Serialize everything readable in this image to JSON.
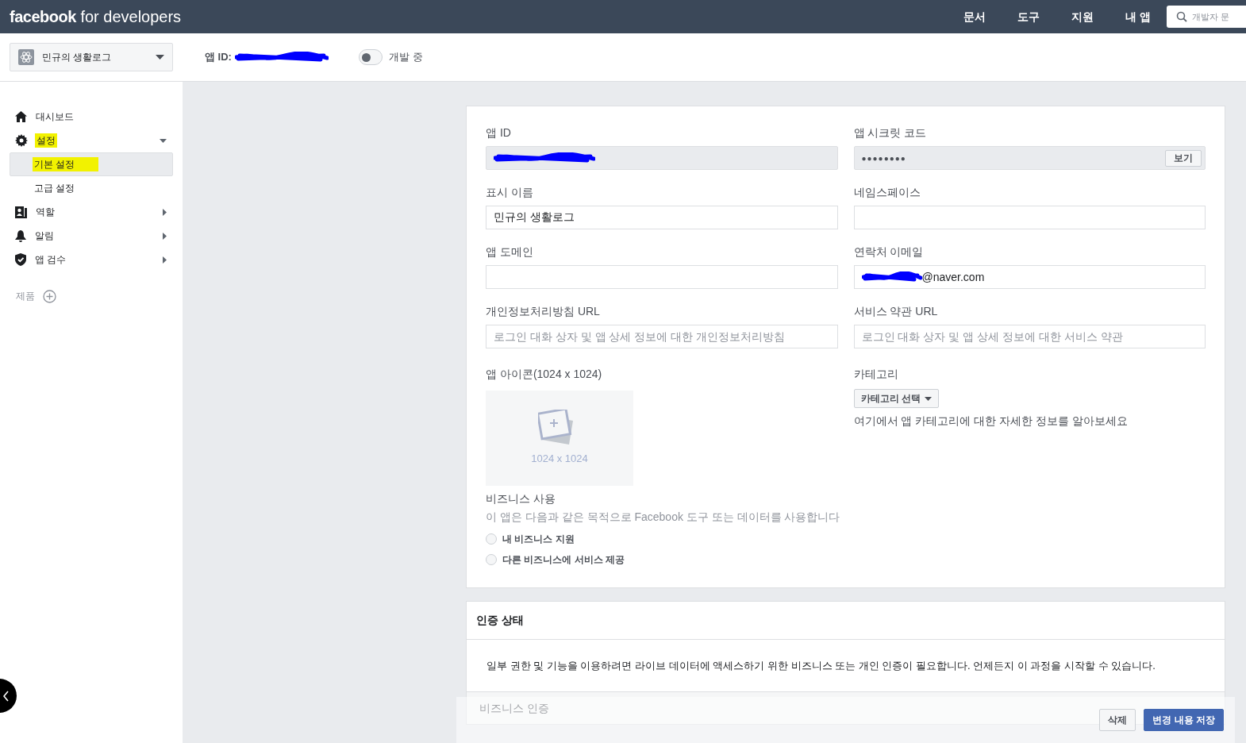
{
  "header": {
    "logo_bold": "facebook",
    "logo_rest": "for developers",
    "nav": [
      {
        "label": "문서"
      },
      {
        "label": "도구"
      },
      {
        "label": "지원"
      },
      {
        "label": "내 앱"
      }
    ],
    "search": {
      "placeholder": "개발자 문"
    }
  },
  "app_bar": {
    "app_name": "민규의 생활로그",
    "app_id_label": "앱 ID:",
    "mode_toggle": {
      "on": false,
      "label": "개발 중"
    }
  },
  "sidebar": {
    "items": [
      {
        "label": "대시보드",
        "kind": "home",
        "highlighted": false
      },
      {
        "label": "설정",
        "kind": "gear",
        "highlighted": true,
        "expanded": true,
        "children": [
          {
            "label": "기본 설정",
            "selected": true,
            "highlighted": true
          },
          {
            "label": "고급 설정",
            "selected": false,
            "highlighted": false
          }
        ]
      },
      {
        "label": "역할",
        "kind": "roles",
        "highlighted": false,
        "expanded": false
      },
      {
        "label": "알림",
        "kind": "bell",
        "highlighted": false,
        "expanded": false
      },
      {
        "label": "앱 검수",
        "kind": "shield",
        "highlighted": false,
        "expanded": false
      }
    ],
    "products_label": "제품"
  },
  "basic_settings": {
    "fields": [
      {
        "kind": "redacted",
        "label": "앱 ID"
      },
      {
        "kind": "secret",
        "label": "앱 시크릿 코드",
        "value": "●●●●●●●●",
        "button": "보기"
      },
      {
        "kind": "text",
        "label": "표시 이름",
        "value": "민규의 생활로그"
      },
      {
        "kind": "text",
        "label": "네임스페이스"
      },
      {
        "kind": "text",
        "label": "앱 도메인"
      },
      {
        "kind": "redacted_email",
        "label": "연락처 이메일",
        "value": "@naver.com"
      },
      {
        "kind": "text",
        "label": "개인정보처리방침 URL",
        "placeholder": "로그인 대화 상자 및 앱 상세 정보에 대한 개인정보처리방침"
      },
      {
        "kind": "text",
        "label": "서비스 약관 URL",
        "placeholder": "로그인 대화 상자 및 앱 상세 정보에 대한 서비스 약관"
      }
    ],
    "app_icon": {
      "label": "앱 아이콘(1024 x 1024)",
      "hint": "1024 x 1024"
    },
    "category": {
      "label": "카테고리",
      "dropdown": "카테고리 선택",
      "help": "여기에서 앱 카테고리에 대한 자세한 정보를 알아보세요"
    },
    "business_use": {
      "label": "비즈니스 사용",
      "description": "이 앱은 다음과 같은 목적으로 Facebook 도구 또는 데이터를 사용합니다",
      "options": [
        {
          "label": "내 비즈니스 지원",
          "selected": false
        },
        {
          "label": "다른 비즈니스에 서비스 제공",
          "selected": false
        }
      ]
    }
  },
  "verification": {
    "title": "인증 상태",
    "body": "일부 권한 및 기능을 이용하려면 라이브 데이터에 액세스하기 위한 비즈니스 또는 개인 인증이 필요합니다. 언제든지 이 과정을 시작할 수 있습니다.",
    "row": "비즈니스 인증"
  },
  "save_bar": {
    "buttons": [
      {
        "label": "삭제",
        "kind": "secondary"
      },
      {
        "label": "변경 내용 저장",
        "kind": "primary"
      }
    ]
  }
}
